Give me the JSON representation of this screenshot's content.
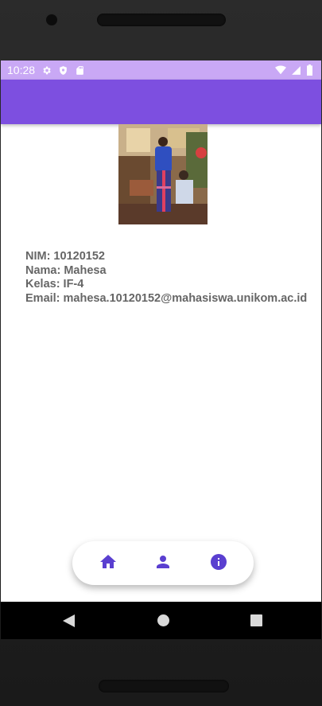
{
  "status_bar": {
    "time": "10:28",
    "left_icons": [
      "gear-icon",
      "shield-icon",
      "sd-card-icon"
    ],
    "right_icons": [
      "wifi-icon",
      "signal-icon",
      "battery-icon"
    ],
    "background": "#c9a8f5"
  },
  "app_bar": {
    "background": "#7d4fe0"
  },
  "profile": {
    "nim": "NIM: 10120152",
    "nama": "Nama: Mahesa",
    "kelas": "Kelas: IF-4",
    "email": "Email: mahesa.10120152@mahasiswa.unikom.ac.id"
  },
  "bottom_nav": {
    "items": [
      {
        "icon": "home-icon"
      },
      {
        "icon": "person-icon"
      },
      {
        "icon": "info-icon"
      }
    ],
    "accent": "#5a3fd0"
  },
  "system_nav": {
    "buttons": [
      "back-icon",
      "home-circle-icon",
      "recents-icon"
    ]
  }
}
